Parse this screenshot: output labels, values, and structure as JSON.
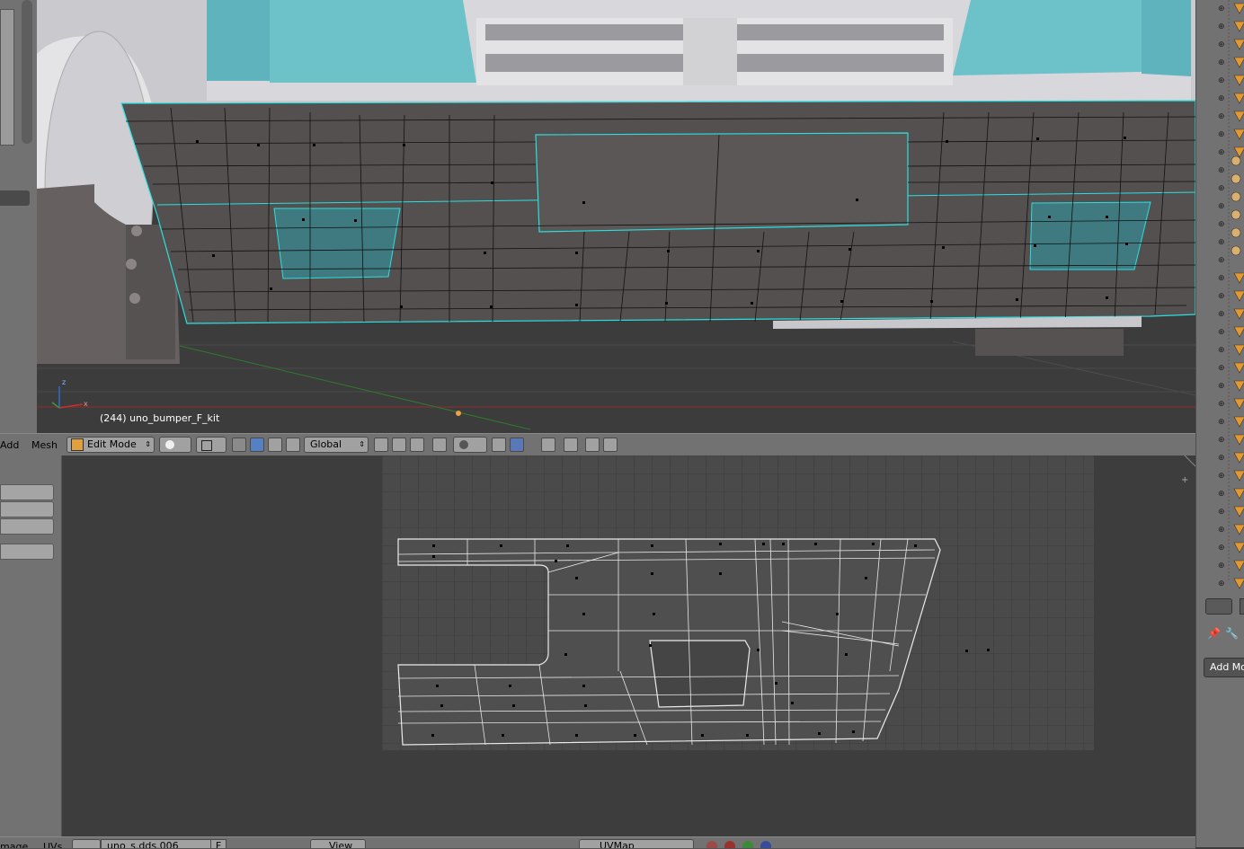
{
  "viewport": {
    "object_info": "(244) uno_bumper_F_kit",
    "axis_z": "z",
    "axis_x": "x"
  },
  "view3d_header": {
    "menu_add": "Add",
    "menu_mesh": "Mesh",
    "mode_label": "Edit Mode",
    "orientation_label": "Global"
  },
  "uv_header": {
    "menu_image": "mage",
    "menu_uvs": "UVs",
    "image_name": "uno_s.dds.006",
    "users_f": "F",
    "view_label": "View",
    "uvmap_label": "UVMap"
  },
  "properties": {
    "add_modifier_label": "Add Mod"
  },
  "icons": [
    "edit-mode-icon",
    "shading-solid-icon",
    "pivot-icon",
    "manipulator-translate-icon",
    "manipulator-rotate-icon",
    "manipulator-scale-icon",
    "vertex-select-icon",
    "edge-select-icon",
    "face-select-icon",
    "limit-selection-icon",
    "proportional-edit-icon",
    "snap-icon",
    "render-icon",
    "camera-icon",
    "lock-icon",
    "pin-icon",
    "wrench-icon",
    "outliner-object-icon"
  ],
  "colors": {
    "mesh_selected": "#29e0e0",
    "mesh_face": "#54504f",
    "window_glass": "#5fb3bc",
    "header_bg": "#727272",
    "uv_image_bg": "#4a4a4a"
  }
}
